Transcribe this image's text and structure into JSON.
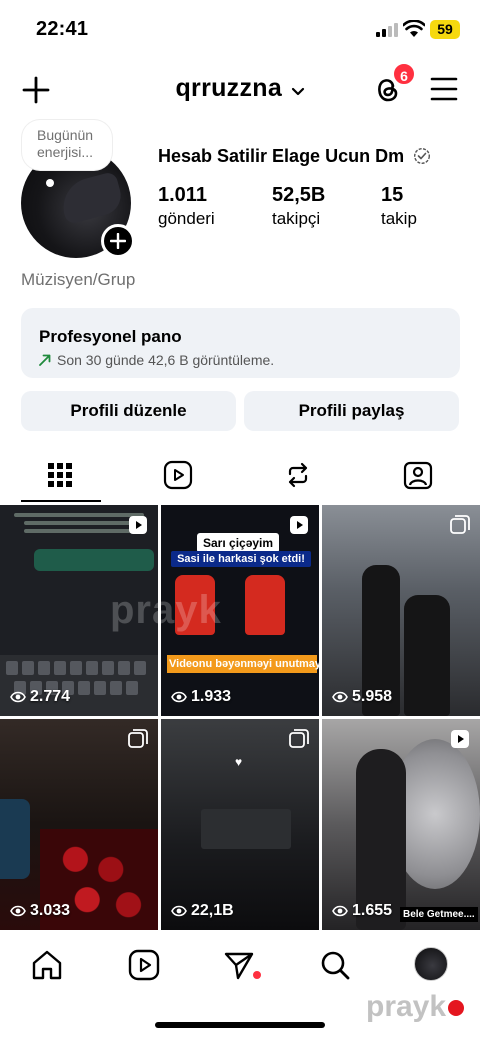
{
  "status_bar": {
    "time": "22:41",
    "battery": "59",
    "battery_color": "#f6d90f"
  },
  "header": {
    "username": "qrruzzna",
    "notification_count": "6",
    "icons": [
      "plus-icon",
      "chevron-down-icon",
      "threads-icon",
      "menu-icon"
    ]
  },
  "profile": {
    "note": "Bugünün enerjisi...",
    "display_name": "Hesab Satilir Elage Ucun Dm",
    "stats": [
      {
        "value": "1.011",
        "label": "gönderi"
      },
      {
        "value": "52,5B",
        "label": "takipçi"
      },
      {
        "value": "15",
        "label": "takip"
      }
    ],
    "category": "Müzisyen/Grup"
  },
  "dashboard": {
    "title": "Profesyonel pano",
    "subtitle": "Son 30 günde 42,6 B görüntüleme.",
    "trend_color": "#1f8a3c"
  },
  "buttons": {
    "edit": "Profili düzenle",
    "share": "Profili paylaş"
  },
  "tabs": [
    "grid-icon",
    "reels-icon",
    "reposts-icon",
    "tagged-icon"
  ],
  "posts": [
    {
      "views": "2.774",
      "type": "reel"
    },
    {
      "views": "1.933",
      "type": "reel",
      "caption_top": "Sarı çiçəyim",
      "caption_mid": "Sasi ile harkasi şok etdi!",
      "caption_bottom": "Videonu bəyənməyi unutmayın"
    },
    {
      "views": "5.958",
      "type": "carousel"
    },
    {
      "views": "3.033",
      "type": "carousel"
    },
    {
      "views": "22,1B",
      "type": "carousel"
    },
    {
      "views": "1.655",
      "type": "reel",
      "caption_tag": "Bele Getmee...."
    }
  ],
  "watermark": "prayk",
  "bottom_nav": [
    "home-icon",
    "reels-icon",
    "send-icon",
    "search-icon",
    "profile-avatar"
  ],
  "brand": "prayk",
  "accent_colors": {
    "badge": "#ff3040",
    "background": "#ffffff",
    "card": "#eff2f6"
  }
}
